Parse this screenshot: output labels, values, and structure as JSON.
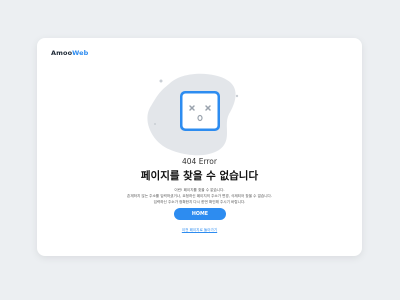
{
  "brand": {
    "part1": "Amoo",
    "part2": "Web"
  },
  "error": {
    "code": "404 Error",
    "title": "페이지를 찾을 수 없습니다",
    "description": [
      "이런! 페이지를 찾을 수 없습니다.",
      "존재하지 않는 주소를 입력하셨거나, 요청하신 페이지의 주소가 변경, 삭제되어 찾을 수 없습니다.",
      "입력하신 주소가 정확한지 다시 한번 확인해 주시기 바랍니다."
    ]
  },
  "actions": {
    "home_label": "HOME",
    "back_link": "이전 페이지로 돌아가기"
  },
  "colors": {
    "accent": "#2d8cf0",
    "blob": "#e3e6ea",
    "icon_frame": "#2d8cf0"
  },
  "icons": {
    "face": "dead-face-icon"
  }
}
